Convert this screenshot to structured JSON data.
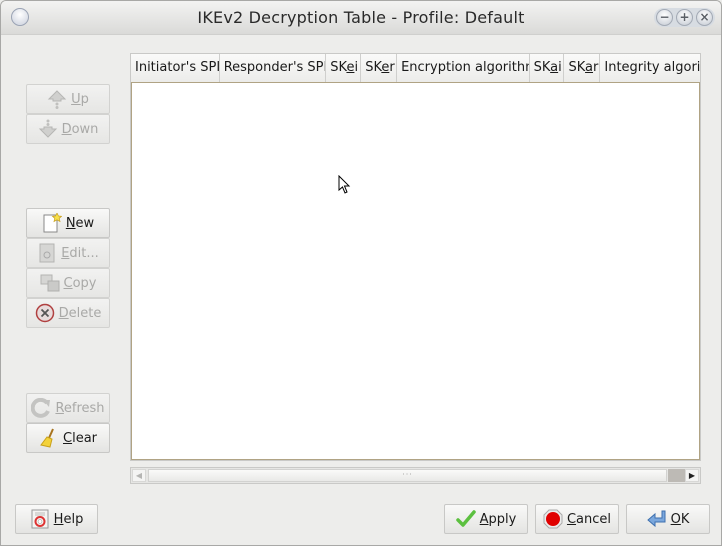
{
  "window": {
    "title": "IKEv2 Decryption Table - Profile: Default",
    "controls": [
      "minimize",
      "maximize",
      "close"
    ]
  },
  "table": {
    "columns": [
      {
        "label": "Initiator's SPI"
      },
      {
        "label": "Responder's SPI"
      },
      {
        "label": "SKei",
        "pre": "SK",
        "mn": "e",
        "post": "i"
      },
      {
        "label": "SKer",
        "pre": "SK",
        "mn": "e",
        "post": "r"
      },
      {
        "label": "Encryption algorithm"
      },
      {
        "label": "SKai",
        "pre": "SK",
        "mn": "a",
        "post": "i"
      },
      {
        "label": "SKar",
        "pre": "SK",
        "mn": "a",
        "post": "r"
      },
      {
        "label": "Integrity algorithm"
      }
    ],
    "rows": []
  },
  "side_buttons": {
    "up": {
      "pre": "",
      "mn": "U",
      "post": "p",
      "enabled": false
    },
    "down": {
      "pre": "",
      "mn": "D",
      "post": "own",
      "enabled": false
    },
    "new": {
      "pre": "",
      "mn": "N",
      "post": "ew",
      "enabled": true
    },
    "edit": {
      "pre": "",
      "mn": "E",
      "post": "dit...",
      "enabled": false
    },
    "copy": {
      "pre": "",
      "mn": "C",
      "post": "opy",
      "enabled": false
    },
    "delete": {
      "pre": "",
      "mn": "D",
      "post": "elete",
      "enabled": false
    },
    "refresh": {
      "pre": "",
      "mn": "R",
      "post": "efresh",
      "enabled": false
    },
    "clear": {
      "pre": "",
      "mn": "C",
      "post": "lear",
      "enabled": true
    }
  },
  "bottom_buttons": {
    "help": {
      "mn": "H",
      "post": "elp"
    },
    "apply": {
      "mn": "A",
      "post": "pply"
    },
    "cancel": {
      "mn": "C",
      "post": "ancel"
    },
    "ok": {
      "mn": "O",
      "post": "K"
    }
  },
  "scrollbar": {
    "grip": "···"
  },
  "colors": {
    "window_bg": "#ededeb",
    "table_border": "#b0a384",
    "disabled_text": "#a9a9a7",
    "cancel_red": "#e00000",
    "apply_green": "#5cc040",
    "ok_blue": "#4a7fc0"
  }
}
